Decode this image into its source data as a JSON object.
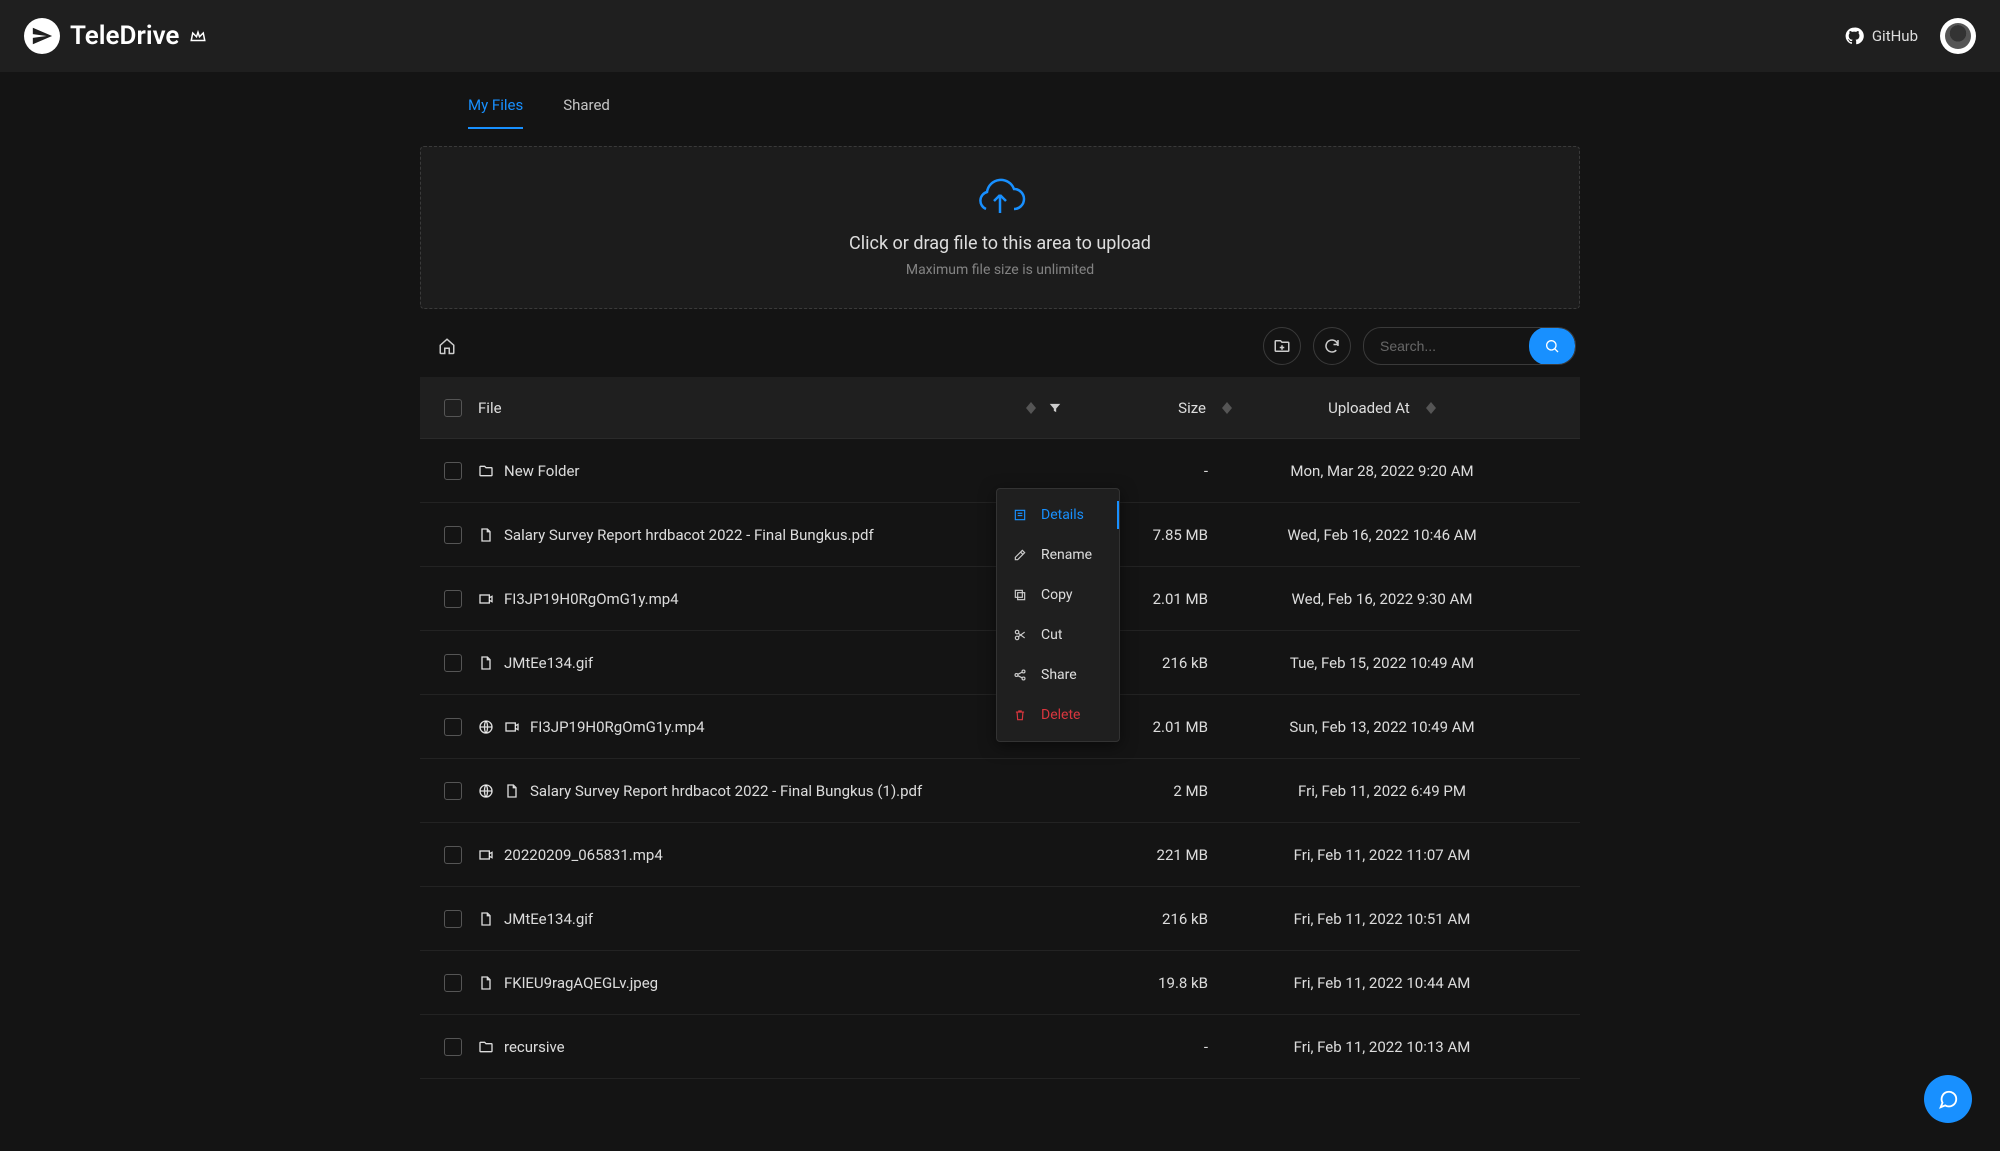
{
  "header": {
    "brand": "TeleDrive",
    "github_label": "GitHub"
  },
  "tabs": {
    "my_files": "My Files",
    "shared": "Shared"
  },
  "dropzone": {
    "title": "Click or drag file to this area to upload",
    "subtitle": "Maximum file size is unlimited"
  },
  "search": {
    "placeholder": "Search..."
  },
  "columns": {
    "file": "File",
    "size": "Size",
    "uploaded": "Uploaded At"
  },
  "context_menu": {
    "details": "Details",
    "rename": "Rename",
    "copy": "Copy",
    "cut": "Cut",
    "share": "Share",
    "delete": "Delete"
  },
  "rows": [
    {
      "icon": "folder",
      "name": "New Folder",
      "size": "-",
      "date": "Mon, Mar 28, 2022 9:20 AM"
    },
    {
      "icon": "file",
      "name": "Salary Survey Report hrdbacot 2022 - Final Bungkus.pdf",
      "size": "7.85 MB",
      "date": "Wed, Feb 16, 2022 10:46 AM"
    },
    {
      "icon": "video",
      "name": "FI3JP19H0RgOmG1y.mp4",
      "size": "2.01 MB",
      "date": "Wed, Feb 16, 2022 9:30 AM"
    },
    {
      "icon": "file",
      "name": "JMtEe134.gif",
      "size": "216 kB",
      "date": "Tue, Feb 15, 2022 10:49 AM"
    },
    {
      "icon": "globe-video",
      "name": "FI3JP19H0RgOmG1y.mp4",
      "size": "2.01 MB",
      "date": "Sun, Feb 13, 2022 10:49 AM"
    },
    {
      "icon": "globe-file",
      "name": "Salary Survey Report hrdbacot 2022 - Final Bungkus (1).pdf",
      "size": "2 MB",
      "date": "Fri, Feb 11, 2022 6:49 PM"
    },
    {
      "icon": "video",
      "name": "20220209_065831.mp4",
      "size": "221 MB",
      "date": "Fri, Feb 11, 2022 11:07 AM"
    },
    {
      "icon": "file",
      "name": "JMtEe134.gif",
      "size": "216 kB",
      "date": "Fri, Feb 11, 2022 10:51 AM"
    },
    {
      "icon": "file",
      "name": "FKlEU9ragAQEGLv.jpeg",
      "size": "19.8 kB",
      "date": "Fri, Feb 11, 2022 10:44 AM"
    },
    {
      "icon": "folder",
      "name": "recursive",
      "size": "-",
      "date": "Fri, Feb 11, 2022 10:13 AM"
    }
  ]
}
